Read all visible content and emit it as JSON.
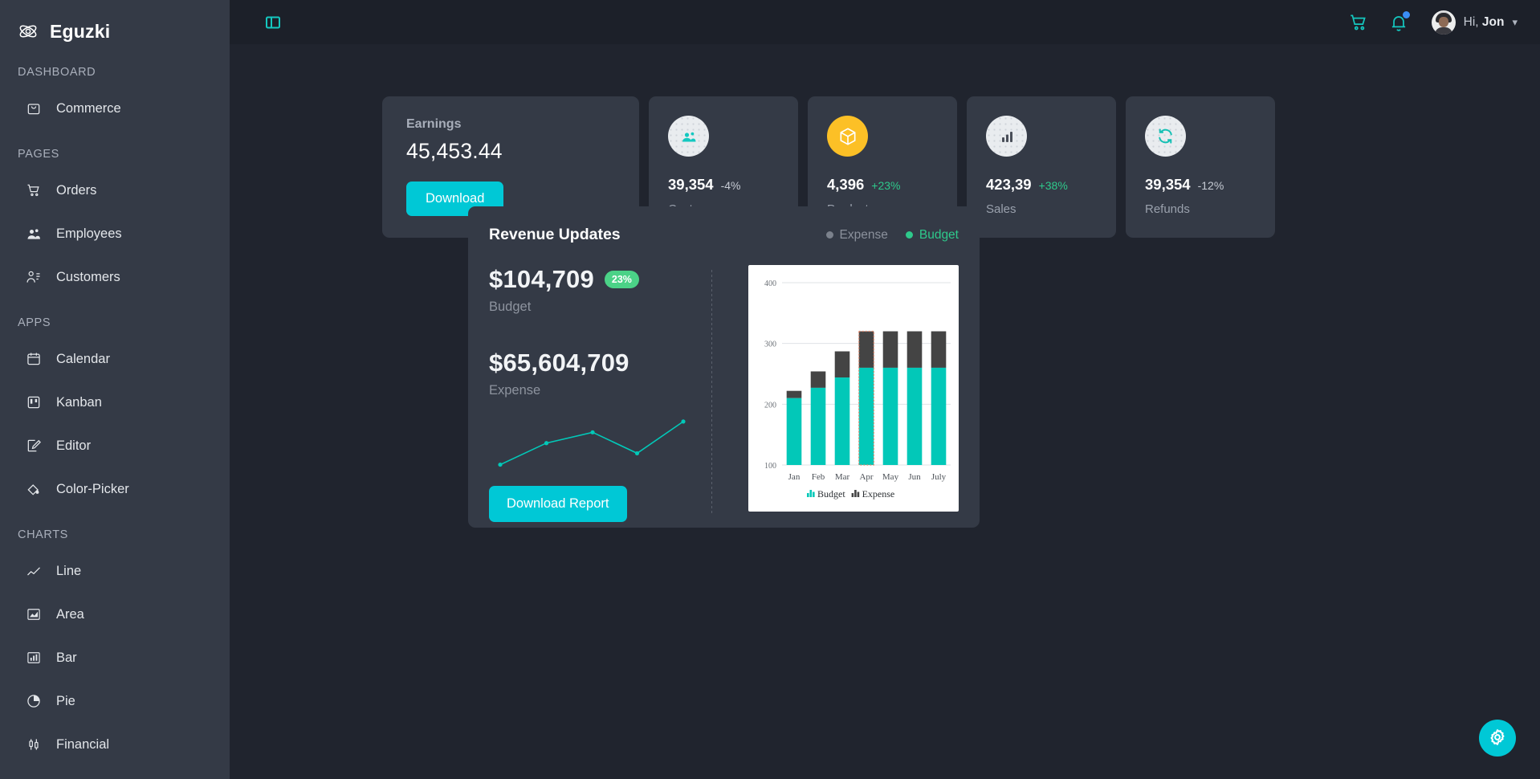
{
  "brand": {
    "name": "Eguzki",
    "logo_icon": "atom-icon"
  },
  "sidebar": {
    "sections": [
      {
        "label": "DASHBOARD",
        "items": [
          {
            "label": "Commerce",
            "icon": "shopping-bag-icon"
          }
        ]
      },
      {
        "label": "PAGES",
        "items": [
          {
            "label": "Orders",
            "icon": "shopping-cart-icon"
          },
          {
            "label": "Employees",
            "icon": "users-icon"
          },
          {
            "label": "Customers",
            "icon": "user-list-icon"
          }
        ]
      },
      {
        "label": "APPS",
        "items": [
          {
            "label": "Calendar",
            "icon": "calendar-icon"
          },
          {
            "label": "Kanban",
            "icon": "kanban-board-icon"
          },
          {
            "label": "Editor",
            "icon": "edit-square-icon"
          },
          {
            "label": "Color-Picker",
            "icon": "color-picker-icon"
          }
        ]
      },
      {
        "label": "CHARTS",
        "items": [
          {
            "label": "Line",
            "icon": "line-chart-icon"
          },
          {
            "label": "Area",
            "icon": "area-chart-icon"
          },
          {
            "label": "Bar",
            "icon": "bar-chart-icon"
          },
          {
            "label": "Pie",
            "icon": "pie-chart-icon"
          },
          {
            "label": "Financial",
            "icon": "financial-chart-icon"
          }
        ]
      }
    ]
  },
  "topbar": {
    "sidebar_toggle_icon": "panel-toggle-icon",
    "cart_icon": "shopping-cart-icon",
    "notification_icon": "bell-icon",
    "has_notification": true,
    "avatar_icon": "user-avatar",
    "greeting_prefix": "Hi,",
    "user_name": "Jon",
    "caret_icon": "chevron-down-icon"
  },
  "earnings": {
    "title": "Earnings",
    "amount": "45,453.44",
    "button_label": "Download"
  },
  "stats": [
    {
      "label": "Customers",
      "value": "39,354",
      "delta": "-4%",
      "delta_dir": "down",
      "icon": "customers-icon",
      "circle": "light"
    },
    {
      "label": "Products",
      "value": "4,396",
      "delta": "+23%",
      "delta_dir": "up",
      "icon": "box-icon",
      "circle": "yellow"
    },
    {
      "label": "Sales",
      "value": "423,39",
      "delta": "+38%",
      "delta_dir": "up",
      "icon": "bar-chart-icon",
      "circle": "light"
    },
    {
      "label": "Refunds",
      "value": "39,354",
      "delta": "-12%",
      "delta_dir": "down",
      "icon": "refresh-icon",
      "circle": "light"
    }
  ],
  "revenue": {
    "title": "Revenue Updates",
    "legend": [
      {
        "label": "Expense",
        "color": "#7b818c"
      },
      {
        "label": "Budget",
        "color": "#2ec98b"
      }
    ],
    "budget_value": "$104,709",
    "budget_badge": "23%",
    "budget_label": "Budget",
    "expense_value": "$65,604,709",
    "expense_label": "Expense",
    "report_button_label": "Download Report"
  },
  "settings_fab": {
    "icon": "gear-icon"
  },
  "colors": {
    "page_bg": "#20242e",
    "panel_bg": "#343a46",
    "topbar_bg": "#1c2029",
    "accent_teal": "#00c8d6",
    "chart_teal": "#02c8b8",
    "budget_green": "#2ec98b",
    "expense_gray": "#444444",
    "product_yellow": "#fcc026",
    "notification_blue": "#3a8ef6"
  },
  "chart_data": {
    "type": "bar",
    "stacked": true,
    "title": "Revenue Updates",
    "xlabel": "",
    "ylabel": "",
    "categories": [
      "Jan",
      "Feb",
      "Mar",
      "Apr",
      "May",
      "Jun",
      "July"
    ],
    "series": [
      {
        "name": "Budget",
        "color": "#02c8b8",
        "values": [
          110,
          127,
          144,
          160,
          160,
          160,
          160
        ]
      },
      {
        "name": "Expense",
        "color": "#444444",
        "values": [
          112,
          127,
          143,
          160,
          160,
          160,
          160
        ]
      }
    ],
    "totals": [
      222,
      254,
      287,
      320,
      320,
      320,
      320
    ],
    "ylim": [
      100,
      400
    ],
    "yticks": [
      100,
      200,
      300,
      400
    ],
    "grid": true,
    "legend": [
      "Budget",
      "Expense"
    ],
    "legend_position": "bottom",
    "highlighted_category": "Apr",
    "plot_background": "#ffffff",
    "sparkline": {
      "type": "line",
      "color": "#02c8b8",
      "points": [
        [
          0,
          18
        ],
        [
          27,
          54
        ],
        [
          54,
          72
        ],
        [
          80,
          37
        ],
        [
          107,
          90
        ]
      ],
      "ylim": [
        0,
        110
      ]
    }
  }
}
